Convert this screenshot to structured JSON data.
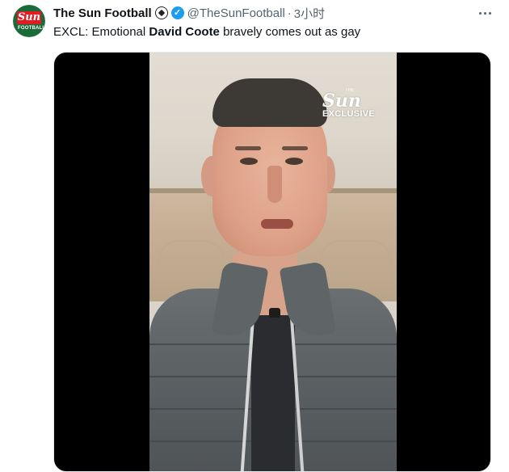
{
  "account": {
    "display_name": "The Sun Football",
    "handle": "@TheSunFootball",
    "separator": "·",
    "time_ago": "3小时",
    "avatar": {
      "logo_text": "Sun",
      "logo_subtext": "FOOTBALL",
      "icon": "sun-football-logo"
    },
    "name_emoji_icon": "soccer-ball-icon",
    "verified_icon": "verified-badge-icon",
    "verified_glyph": "✓"
  },
  "tweet": {
    "text_prefix": "EXCL: Emotional ",
    "text_bold": "David Coote",
    "text_suffix": " bravely comes out as gay"
  },
  "more_icon": "more-horizontal-icon",
  "media": {
    "type": "video",
    "watermark": {
      "the": "THE",
      "brand": "Sun",
      "label": "EXCLUSIVE"
    }
  },
  "colors": {
    "verified": "#1d9bf0",
    "secondary_text": "#536471",
    "logo_red": "#e31b23",
    "logo_green": "#1b6a3a"
  }
}
